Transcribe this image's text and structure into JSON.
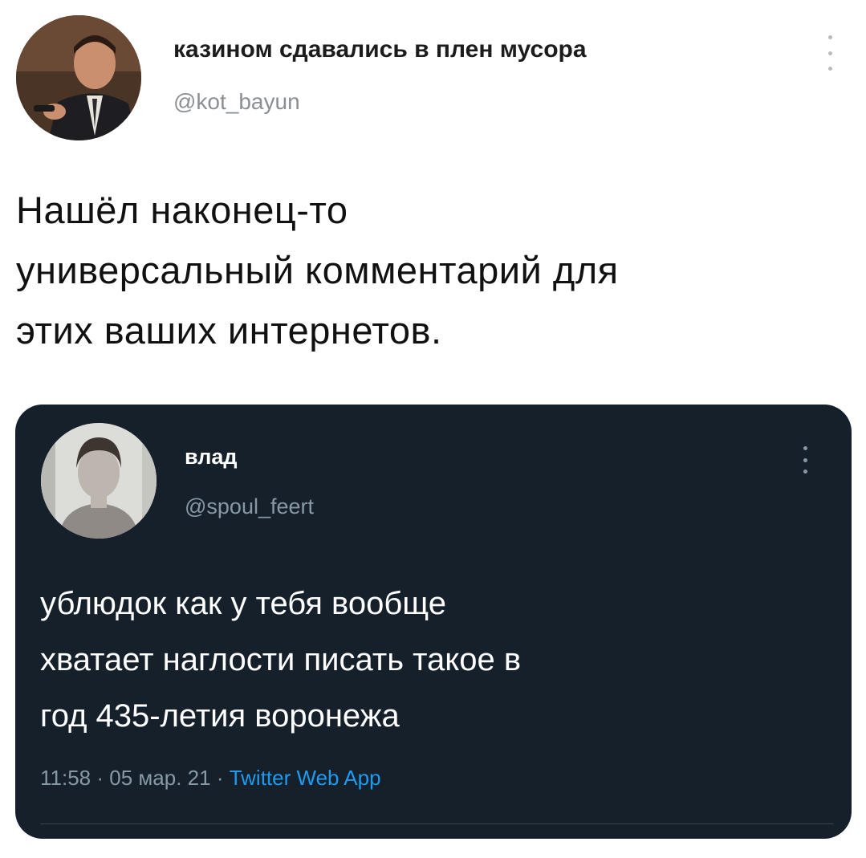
{
  "outer_tweet": {
    "author_name": "казином сдавались в плен мусора",
    "author_handle": "@kot_bayun",
    "avatar_icon": "user-avatar-photo",
    "more_icon": "more-vertical-icon",
    "text_lines": [
      "Нашёл наконец-то",
      "универсальный комментарий для",
      "этих ваших интернетов."
    ]
  },
  "quoted_tweet": {
    "author_name": "влад",
    "author_handle": "@spoul_feert",
    "avatar_icon": "user-avatar-photo",
    "more_icon": "more-vertical-icon",
    "text_lines": [
      "ублюдок как у тебя вообще",
      "хватает наглости писать такое в",
      "год 435-летия воронежа"
    ],
    "time": "11:58",
    "separator": "·",
    "date": "05 мар. 21",
    "source": "Twitter Web App",
    "colors": {
      "background": "#15202b",
      "text": "#ffffff",
      "secondary": "#8899a6",
      "link": "#1d9bf0"
    }
  }
}
